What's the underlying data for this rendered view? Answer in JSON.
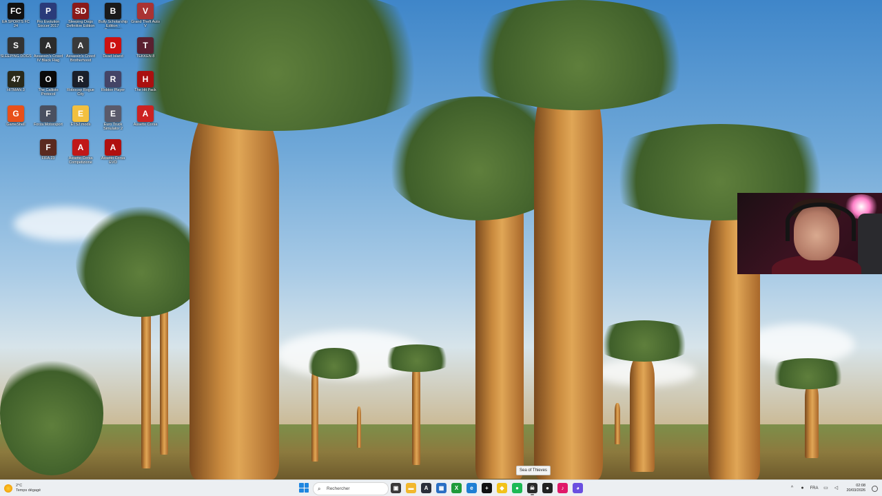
{
  "desktop_icons": [
    {
      "label": "EA SPORTS FC 24",
      "color": "#111111",
      "glyph": "FC"
    },
    {
      "label": "Pro Evolution Soccer 2017",
      "color": "#2a3b7a",
      "glyph": "P"
    },
    {
      "label": "Sleeping Dogs Definitive Edition",
      "color": "#8a1a1a",
      "glyph": "SD"
    },
    {
      "label": "Bully Scholarship Edition - Raccourci",
      "color": "#1a1a1a",
      "glyph": "B"
    },
    {
      "label": "Grand Theft Auto V",
      "color": "#a33",
      "glyph": "V"
    },
    {
      "label": "SLEEPING DOGS",
      "color": "#333333",
      "glyph": "S"
    },
    {
      "label": "Assassin's Creed IV Black Flag",
      "color": "#2b2b2b",
      "glyph": "A"
    },
    {
      "label": "Assassin's Creed Brotherhood",
      "color": "#3a3a3a",
      "glyph": "A"
    },
    {
      "label": "Dead Island",
      "color": "#cc1111",
      "glyph": "D"
    },
    {
      "label": "TEKKEN 8",
      "color": "#5a2030",
      "glyph": "T"
    },
    {
      "label": "HITMAN 3",
      "color": "#2a2a1a",
      "glyph": "47"
    },
    {
      "label": "The Callisto Protocol",
      "color": "#0a0a0a",
      "glyph": "O"
    },
    {
      "label": "Robocop Rogue City",
      "color": "#1a1f2a",
      "glyph": "R"
    },
    {
      "label": "Roblox Player",
      "color": "#444466",
      "glyph": "R"
    },
    {
      "label": "The Hit Pack",
      "color": "#aa1010",
      "glyph": "H"
    },
    {
      "label": "GameShell",
      "color": "#e8501a",
      "glyph": "G"
    },
    {
      "label": "Forza Motorsport",
      "color": "#4a5060",
      "glyph": "F"
    },
    {
      "label": "ETS2 mods",
      "color": "#f2c040",
      "glyph": "E"
    },
    {
      "label": "Euro Truck Simulator 2",
      "color": "#5a5a6a",
      "glyph": "E"
    },
    {
      "label": "Assetto Corsa",
      "color": "#cc2222",
      "glyph": "A"
    },
    {
      "label": "FIFA 23",
      "color": "#5a2a20",
      "glyph": "F"
    },
    {
      "label": "Assetto Corsa Competizione",
      "color": "#c01818",
      "glyph": "A"
    },
    {
      "label": "Assetto Corsa EVO",
      "color": "#b01010",
      "glyph": "A"
    }
  ],
  "tooltip": "Sea of Thieves",
  "taskbar": {
    "weather": {
      "temp": "2°C",
      "condition": "Temps dégagé"
    },
    "search_placeholder": "Rechercher",
    "apps": [
      {
        "name": "task-view",
        "glyph": "▣",
        "color": "#3a3a3a"
      },
      {
        "name": "file-explorer",
        "glyph": "▬",
        "color": "#f2b82e"
      },
      {
        "name": "app-a",
        "glyph": "A",
        "color": "#2b2f3a"
      },
      {
        "name": "app-store",
        "glyph": "▦",
        "color": "#2a6fc4"
      },
      {
        "name": "xbox",
        "glyph": "X",
        "color": "#1f9a3a"
      },
      {
        "name": "edge",
        "glyph": "e",
        "color": "#1f7fd4"
      },
      {
        "name": "epic",
        "glyph": "+",
        "color": "#111111"
      },
      {
        "name": "app-yellow",
        "glyph": "◆",
        "color": "#f2c21a"
      },
      {
        "name": "spotify",
        "glyph": "●",
        "color": "#1db954"
      },
      {
        "name": "sea-of-thieves",
        "glyph": "☠",
        "color": "#2a2a2a"
      },
      {
        "name": "app-red",
        "glyph": "●",
        "color": "#222222"
      },
      {
        "name": "tiktok",
        "glyph": "♪",
        "color": "#e0196a"
      },
      {
        "name": "discord",
        "glyph": "◕",
        "color": "#6a4fe0"
      }
    ],
    "tray": {
      "lang": "FRA",
      "time": "02:08",
      "date": "20/03/2026"
    }
  }
}
